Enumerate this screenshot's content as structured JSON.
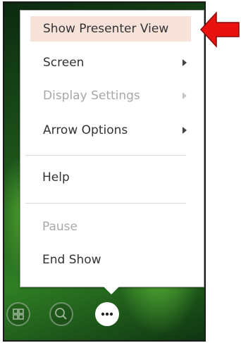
{
  "menu": {
    "items": [
      {
        "label": "Show Presenter View",
        "disabled": false,
        "submenu": false,
        "highlight": true
      },
      {
        "label": "Screen",
        "disabled": false,
        "submenu": true
      },
      {
        "label": "Display Settings",
        "disabled": true,
        "submenu": true
      },
      {
        "label": "Arrow Options",
        "disabled": false,
        "submenu": true
      },
      {
        "label": "Help",
        "disabled": false,
        "submenu": false
      },
      {
        "label": "Pause",
        "disabled": true,
        "submenu": false
      },
      {
        "label": "End Show",
        "disabled": false,
        "submenu": false
      }
    ]
  },
  "controls": {
    "icons": [
      "slides-grid-icon",
      "zoom-icon",
      "more-options-icon"
    ],
    "more_label": "•••"
  },
  "colors": {
    "highlight": "#f7e2da",
    "pointer_arrow": "#e8120e",
    "disabled_text": "#a8a8a8"
  },
  "annotation": {
    "pointer": "red-arrow-icon"
  }
}
